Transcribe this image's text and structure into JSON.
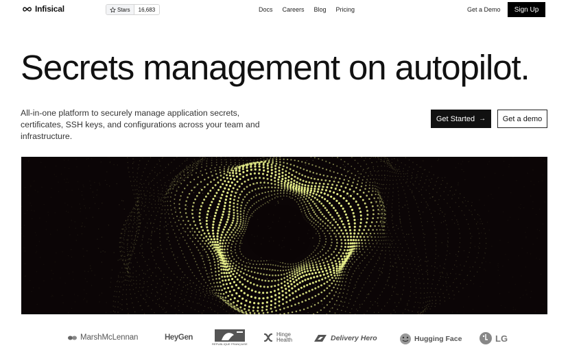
{
  "nav": {
    "brand": "Infisical",
    "github": {
      "stars_label": "Stars",
      "count": "16,683"
    },
    "links": [
      "Docs",
      "Careers",
      "Blog",
      "Pricing"
    ],
    "demo_label": "Get a Demo",
    "signup_label": "Sign Up"
  },
  "hero": {
    "headline": "Secrets management on autopilot.",
    "subtitle": "All-in-one platform to securely manage application secrets, certificates, SSH keys, and configurations across your team and infrastructure.",
    "primary_cta": "Get Started",
    "secondary_cta": "Get a demo"
  },
  "visual": {
    "background_color": "#0b0506",
    "accent_color": "#e8f08a"
  },
  "customers": [
    {
      "name": "MarshMcLennan",
      "icon": "marsh-mclennan-logo"
    },
    {
      "name": "HeyGen",
      "icon": "heygen-logo"
    },
    {
      "name": "RÉPUBLIQUE FRANÇAISE",
      "icon": "french-republic-logo"
    },
    {
      "name": "Hinge Health",
      "icon": "hinge-health-logo"
    },
    {
      "name": "Delivery Hero",
      "icon": "delivery-hero-logo"
    },
    {
      "name": "Hugging Face",
      "icon": "hugging-face-logo"
    },
    {
      "name": "LG",
      "icon": "lg-logo"
    }
  ]
}
